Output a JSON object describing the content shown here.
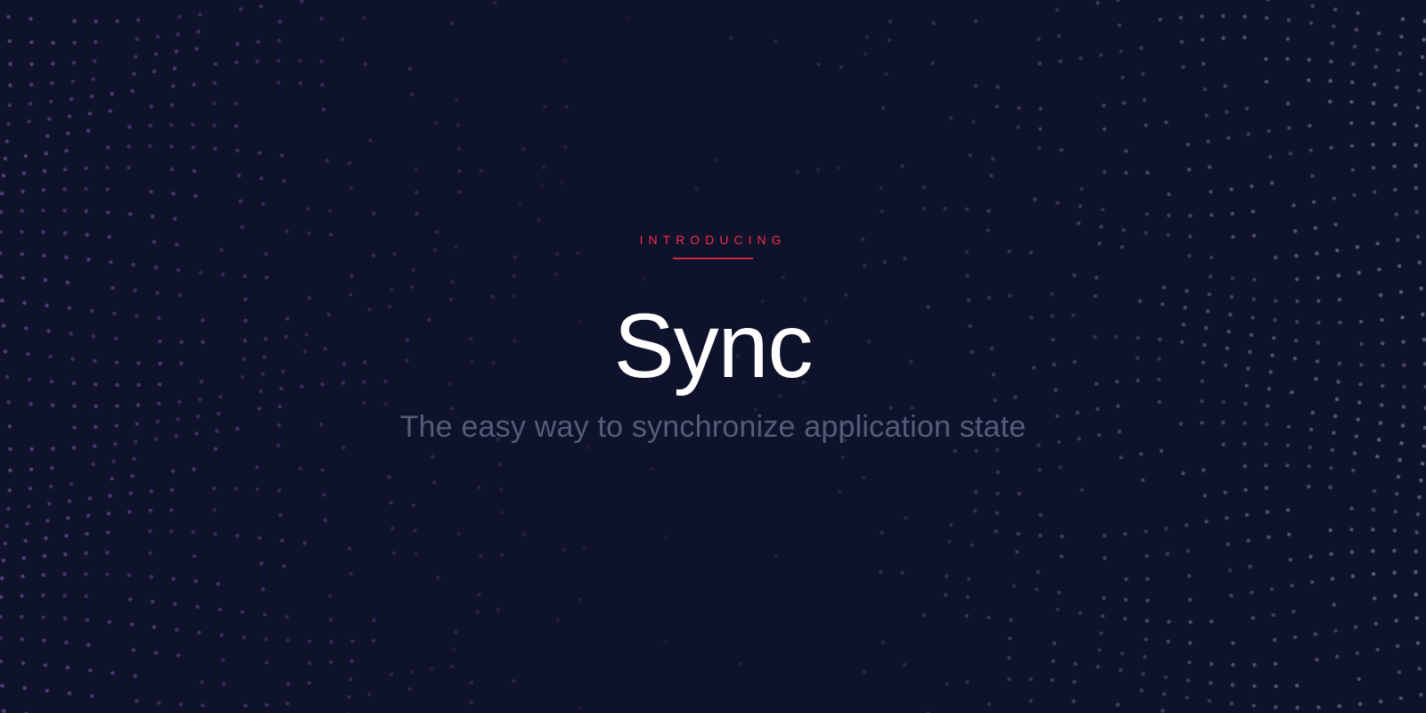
{
  "hero": {
    "eyebrow": "INTRODUCING",
    "title": "Sync",
    "subtitle": "The easy way to synchronize application state"
  },
  "colors": {
    "background": "#0f122b",
    "accent": "#f22f46",
    "title": "#ffffff",
    "subtitle": "#565b78",
    "dots_left": "#6d5aa8",
    "dots_right": "#8a8fa3"
  }
}
